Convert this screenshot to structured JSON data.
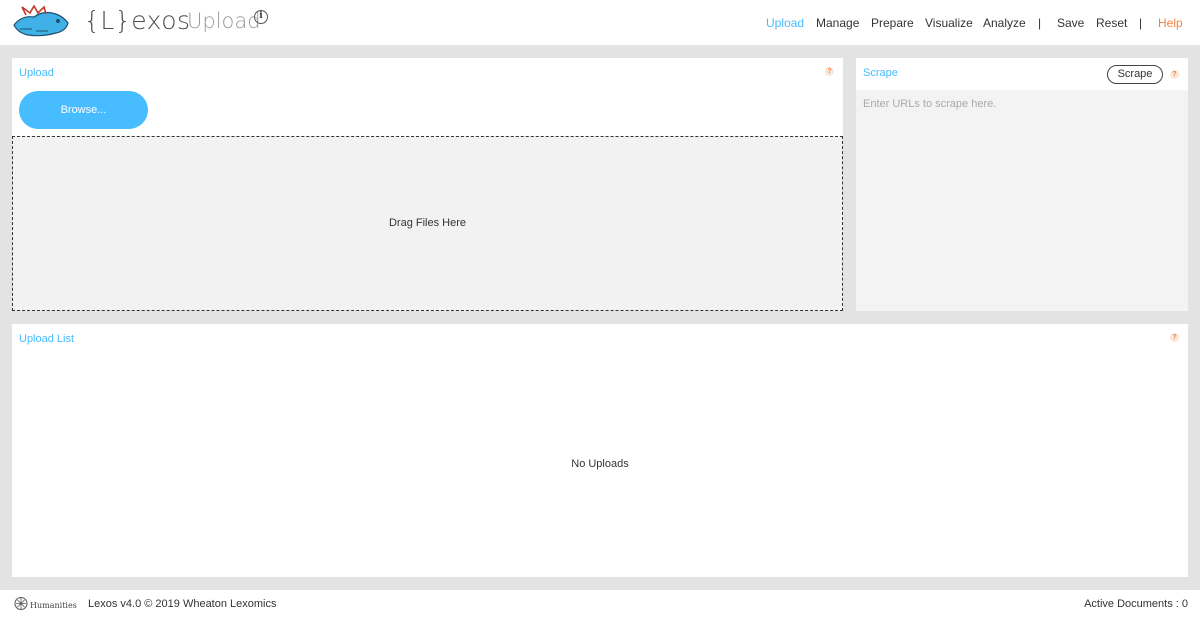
{
  "header": {
    "brand": "{L}exos",
    "page_title": "Upload",
    "info_icon": "i"
  },
  "nav": {
    "items": [
      {
        "label": "Upload",
        "active": true
      },
      {
        "label": "Manage"
      },
      {
        "label": "Prepare"
      },
      {
        "label": "Visualize"
      },
      {
        "label": "Analyze"
      },
      {
        "label": "Save"
      },
      {
        "label": "Reset"
      },
      {
        "label": "Help",
        "accent": true
      }
    ],
    "separator": "|"
  },
  "upload": {
    "title": "Upload",
    "help": "?",
    "browse_label": "Browse...",
    "drop_text": "Drag Files Here"
  },
  "scrape": {
    "title": "Scrape",
    "help": "?",
    "button_label": "Scrape",
    "placeholder": "Enter URLs to scrape here."
  },
  "upload_list": {
    "title": "Upload List",
    "help": "?",
    "empty_text": "No Uploads"
  },
  "footer": {
    "text": "Lexos v4.0 © 2019 Wheaton Lexomics",
    "active_documents": "Active Documents : 0",
    "neh_logo": "Humanities"
  },
  "colors": {
    "accent_blue": "#47bcff",
    "help_orange": "#f5823b",
    "background": "#e3e3e3"
  }
}
